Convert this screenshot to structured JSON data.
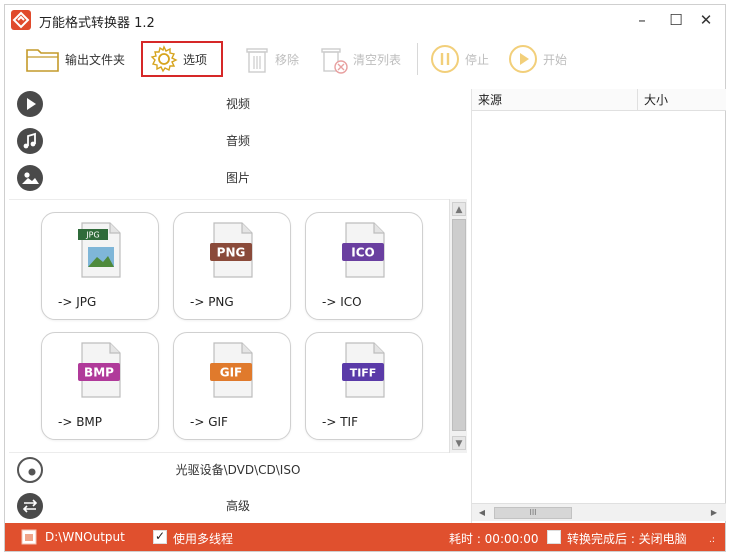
{
  "window": {
    "title": "万能格式转换器 1.2",
    "controls": {
      "minimize": "–",
      "maximize": "☐",
      "close": "✕"
    }
  },
  "toolbar": {
    "output_folder": "输出文件夹",
    "options": "选项",
    "remove": "移除",
    "clear_list": "清空列表",
    "stop": "停止",
    "start": "开始"
  },
  "categories": {
    "video": "视频",
    "audio": "音频",
    "image": "图片",
    "optical": "光驱设备\\DVD\\CD\\ISO",
    "advanced": "高级"
  },
  "formats": [
    {
      "badge": "JPG",
      "label": "-> JPG",
      "color": "#2f6b3a"
    },
    {
      "badge": "PNG",
      "label": "-> PNG",
      "color": "#8a4a3a"
    },
    {
      "badge": "ICO",
      "label": "-> ICO",
      "color": "#6a3fa0"
    },
    {
      "badge": "BMP",
      "label": "-> BMP",
      "color": "#b03a9a"
    },
    {
      "badge": "GIF",
      "label": "-> GIF",
      "color": "#e07a2c"
    },
    {
      "badge": "TIFF",
      "label": "-> TIF",
      "color": "#5a3aa8"
    }
  ],
  "file_list": {
    "columns": {
      "source": "来源",
      "size": "大小"
    },
    "hscroll_grip": "III"
  },
  "status": {
    "output_path": "D:\\WNOutput",
    "multithread_label": "使用多线程",
    "multithread_checked": true,
    "elapsed": "耗时 : 00:00:00",
    "after_convert": "转换完成后 : 关闭电脑",
    "after_convert_checked": false
  },
  "colors": {
    "accent": "#e0502e",
    "highlight": "#d62828"
  }
}
